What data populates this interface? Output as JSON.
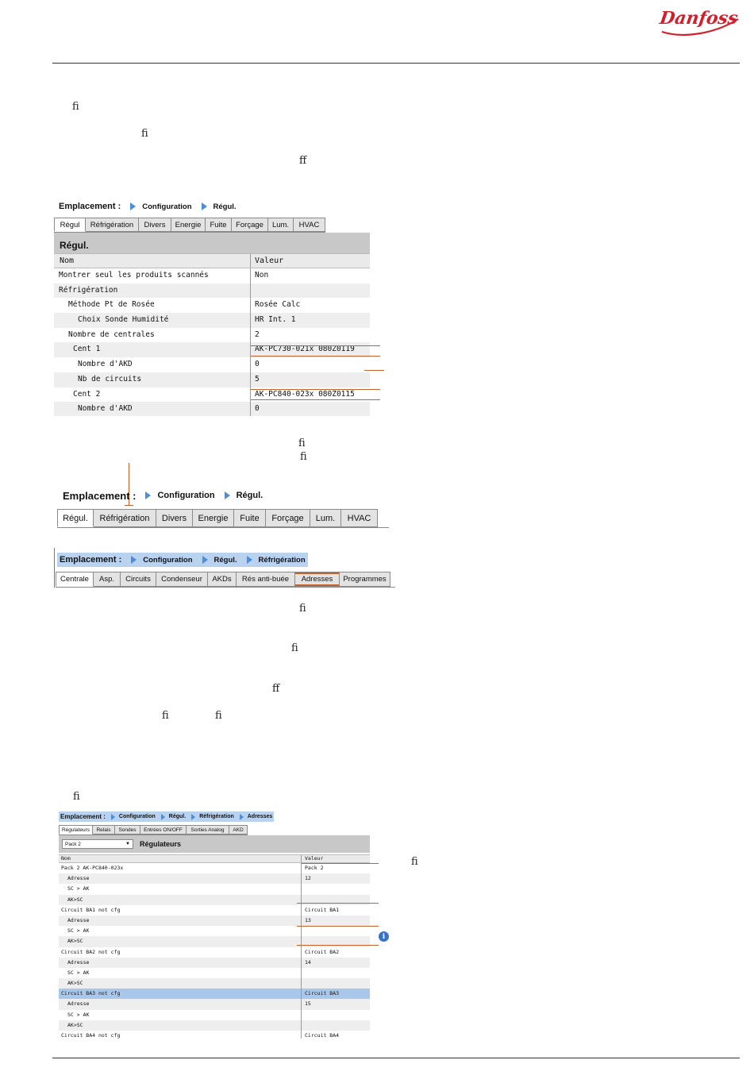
{
  "brand": {
    "logo_text": "Danfoss",
    "color": "#d61e2b"
  },
  "ligatures": [
    {
      "id": "l1",
      "text": "ﬁ"
    },
    {
      "id": "l2",
      "text": "ﬁ"
    },
    {
      "id": "l3",
      "text": "ﬀ"
    },
    {
      "id": "l4",
      "text": "ﬁ"
    },
    {
      "id": "l5",
      "text": "ﬁ"
    },
    {
      "id": "l6",
      "text": "ﬁ"
    },
    {
      "id": "l7",
      "text": "ﬁ"
    },
    {
      "id": "l8",
      "text": "ﬀ"
    },
    {
      "id": "l9",
      "text": "ﬁ"
    },
    {
      "id": "l10",
      "text": "ﬁ"
    },
    {
      "id": "l11",
      "text": "ﬁ"
    },
    {
      "id": "l12",
      "text": "ﬁ"
    }
  ],
  "shot1": {
    "breadcrumb": {
      "label": "Emplacement :",
      "items": [
        "Configuration",
        "Régul."
      ]
    },
    "tabs": [
      "Régul",
      "Réfrigération",
      "Divers",
      "Energie",
      "Fuite",
      "Forçage",
      "Lum.",
      "HVAC"
    ],
    "panel_title": "Régul.",
    "columns": [
      "Nom",
      "Valeur"
    ],
    "rows": [
      {
        "name": "Montrer seul les produits scannés",
        "value": "Non"
      },
      {
        "name": "Réfrigération",
        "value": ""
      },
      {
        "name": "Méthode Pt de Rosée",
        "value": "Rosée Calc"
      },
      {
        "name": "Choix Sonde Humidité",
        "value": "HR Int. 1"
      },
      {
        "name": "Nombre de centrales",
        "value": "2"
      },
      {
        "name": "Cent 1",
        "value": "AK-PC730-021x 080Z0119"
      },
      {
        "name": "Nombre d'AKD",
        "value": "0"
      },
      {
        "name": "Nb de circuits",
        "value": "5"
      },
      {
        "name": "Cent 2",
        "value": "AK-PC840-023x 080Z0115"
      },
      {
        "name": "Nombre d'AKD",
        "value": "0"
      }
    ]
  },
  "shot2": {
    "breadcrumb": {
      "label": "Emplacement :",
      "items": [
        "Configuration",
        "Régul."
      ]
    },
    "tabs": [
      "Régul.",
      "Réfrigération",
      "Divers",
      "Energie",
      "Fuite",
      "Forçage",
      "Lum.",
      "HVAC"
    ]
  },
  "shot3": {
    "breadcrumb": {
      "label": "Emplacement :",
      "items": [
        "Configuration",
        "Régul.",
        "Réfrigération"
      ]
    },
    "tabs": [
      "Centrale",
      "Asp.",
      "Circuits",
      "Condenseur",
      "AKDs",
      "Rés anti-buée",
      "Adresses",
      "Programmes"
    ]
  },
  "shot4": {
    "breadcrumb": {
      "label": "Emplacement :",
      "items": [
        "Configuration",
        "Régul.",
        "Réfrigération",
        "Adresses"
      ]
    },
    "tabs": [
      "Régulateurs",
      "Relais",
      "Sondes",
      "Entrées ON/OFF",
      "Sorties Analog",
      "AKD"
    ],
    "select_value": "Pack 2",
    "panel_title": "Régulateurs",
    "columns": [
      "Nom",
      "Valeur"
    ],
    "rows": [
      {
        "name": "Pack 2 AK-PC840-023x",
        "value": "Pack 2"
      },
      {
        "name": "Adresse",
        "value": "12"
      },
      {
        "name": "SC > AK",
        "value": ""
      },
      {
        "name": "AK>SC",
        "value": ""
      },
      {
        "name": "Circuit BA1 not cfg",
        "value": "Circuit BA1"
      },
      {
        "name": "Adresse",
        "value": "13"
      },
      {
        "name": "SC > AK",
        "value": ""
      },
      {
        "name": "AK>SC",
        "value": ""
      },
      {
        "name": "Circuit BA2 not cfg",
        "value": "Circuit BA2"
      },
      {
        "name": "Adresse",
        "value": "14"
      },
      {
        "name": "SC > AK",
        "value": ""
      },
      {
        "name": "AK>SC",
        "value": ""
      },
      {
        "name": "Circuit BA3 not cfg",
        "value": "Circuit BA3"
      },
      {
        "name": "Adresse",
        "value": "15"
      },
      {
        "name": "SC > AK",
        "value": ""
      },
      {
        "name": "AK>SC",
        "value": ""
      },
      {
        "name": "Circuit BA4 not cfg",
        "value": "Circuit BA4"
      }
    ],
    "info_icon": "i"
  }
}
